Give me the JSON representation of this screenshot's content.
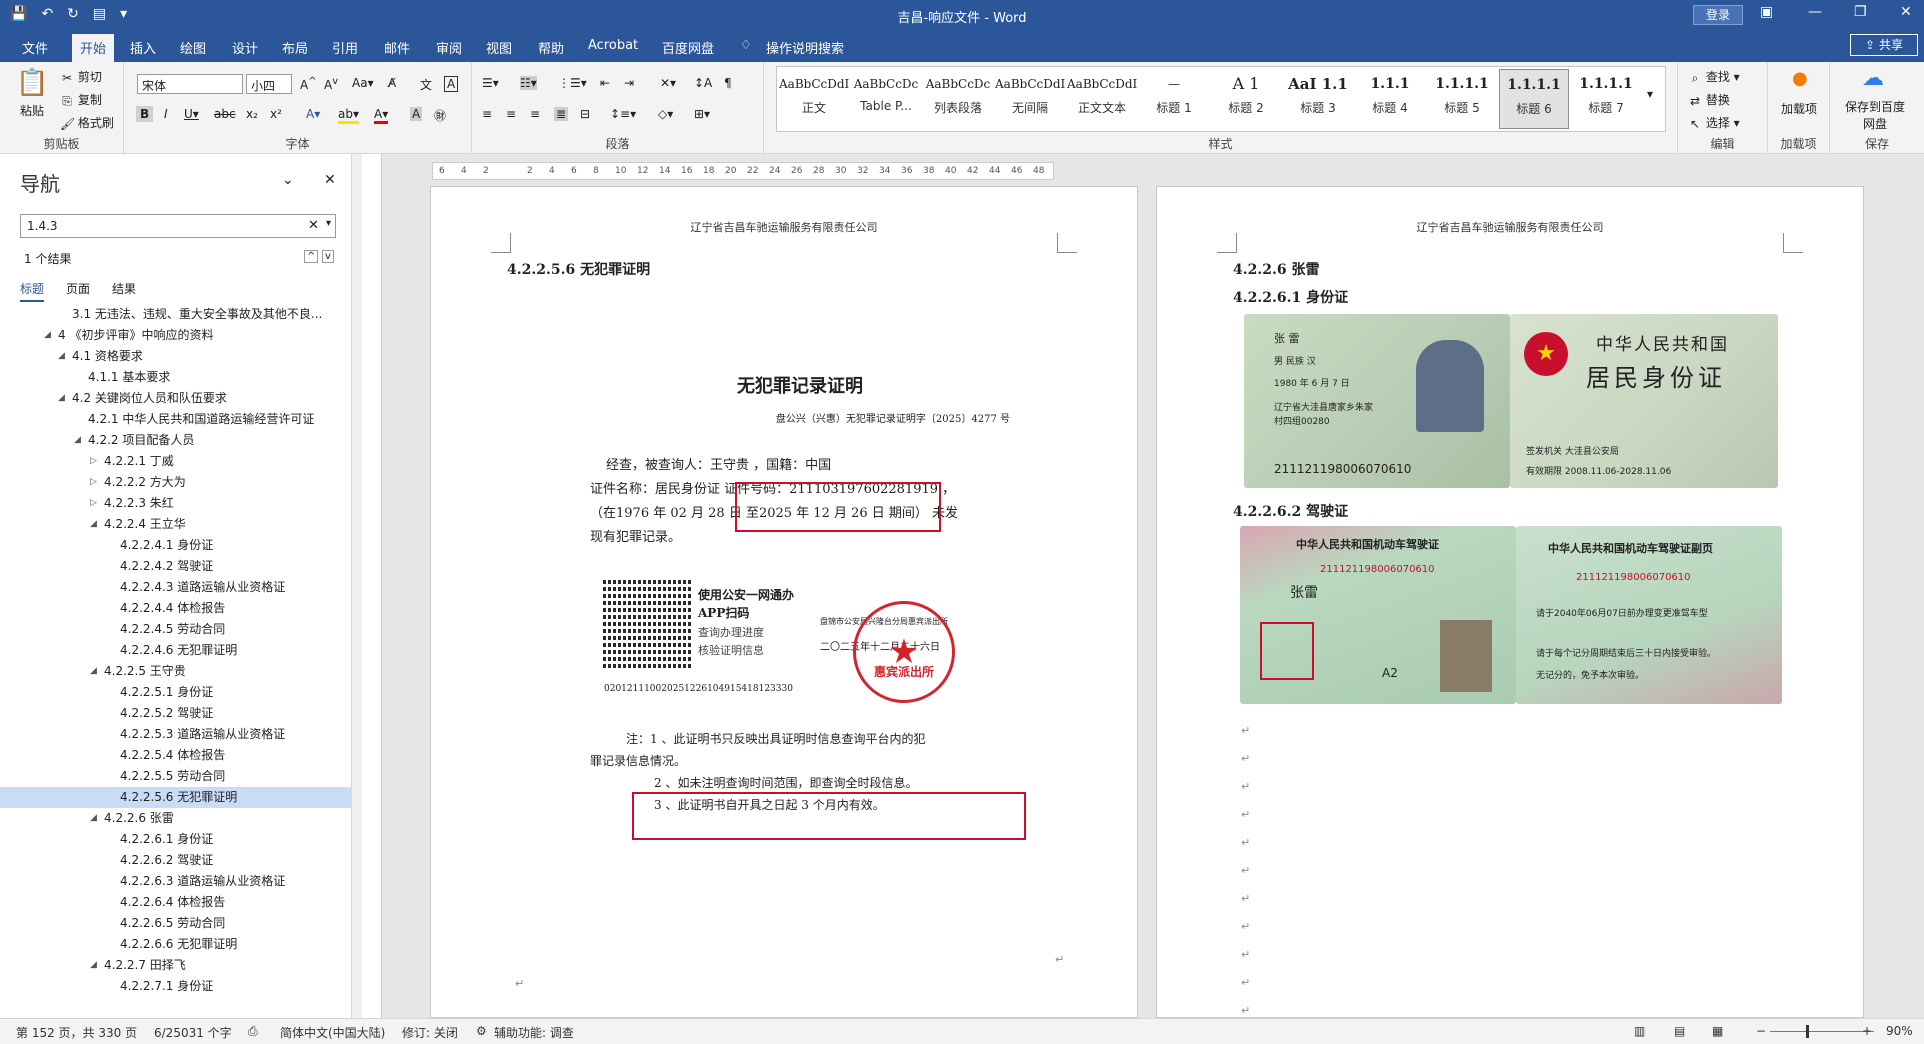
{
  "titlebar": {
    "title": "吉昌-响应文件 - Word",
    "login": "登录"
  },
  "tabs": [
    "文件",
    "开始",
    "插入",
    "绘图",
    "设计",
    "布局",
    "引用",
    "邮件",
    "审阅",
    "视图",
    "帮助",
    "Acrobat",
    "百度网盘",
    "操作说明搜索"
  ],
  "share": "共享",
  "clipboard": {
    "paste": "粘贴",
    "cut": "剪切",
    "copy": "复制",
    "format": "格式刷",
    "label": "剪贴板"
  },
  "font": {
    "name": "宋体",
    "size": "小四",
    "label": "字体"
  },
  "paragraph": {
    "label": "段落"
  },
  "styles": {
    "label": "样式",
    "items": [
      {
        "preview": "AaBbCcDdI",
        "name": "正文"
      },
      {
        "preview": "AaBbCcDc",
        "name": "Table P..."
      },
      {
        "preview": "AaBbCcDc",
        "name": "列表段落"
      },
      {
        "preview": "AaBbCcDdI",
        "name": "无间隔"
      },
      {
        "preview": "AaBbCcDdI",
        "name": "正文文本"
      },
      {
        "preview": "—",
        "name": "标题 1"
      },
      {
        "preview": "A 1",
        "name": "标题 2"
      },
      {
        "preview": "AaI 1.1",
        "name": "标题 3"
      },
      {
        "preview": "1.1.1",
        "name": "标题 4"
      },
      {
        "preview": "1.1.1.1",
        "name": "标题 5"
      },
      {
        "preview": "1.1.1.1",
        "name": "标题 6"
      },
      {
        "preview": "1.1.1.1",
        "name": "标题 7"
      }
    ]
  },
  "editing": {
    "find": "查找",
    "replace": "替换",
    "select": "选择",
    "label": "编辑"
  },
  "addins": {
    "name": "加载项",
    "label": "加载项"
  },
  "save": {
    "name": "保存到百度网盘",
    "label": "保存"
  },
  "nav": {
    "title": "导航",
    "search": "1.4.3",
    "count": "1 个结果",
    "tabs": [
      "标题",
      "页面",
      "结果"
    ],
    "items": [
      {
        "text": "3.1 无违法、违规、重大安全事故及其他不良...",
        "lvl": 0,
        "tg": ""
      },
      {
        "text": "4 《初步评审》中响应的资料",
        "lvl": 0,
        "tg": "◢"
      },
      {
        "text": "4.1 资格要求",
        "lvl": 1,
        "tg": "◢"
      },
      {
        "text": "4.1.1 基本要求",
        "lvl": 2,
        "tg": ""
      },
      {
        "text": "4.2 关键岗位人员和队伍要求",
        "lvl": 1,
        "tg": "◢"
      },
      {
        "text": "4.2.1 中华人民共和国道路运输经营许可证",
        "lvl": 2,
        "tg": ""
      },
      {
        "text": "4.2.2 项目配备人员",
        "lvl": 2,
        "tg": "◢"
      },
      {
        "text": "4.2.2.1 丁威",
        "lvl": 3,
        "tg": "▷"
      },
      {
        "text": "4.2.2.2 方大为",
        "lvl": 3,
        "tg": "▷"
      },
      {
        "text": "4.2.2.3 朱红",
        "lvl": 3,
        "tg": "▷"
      },
      {
        "text": "4.2.2.4 王立华",
        "lvl": 3,
        "tg": "◢"
      },
      {
        "text": "4.2.2.4.1 身份证",
        "lvl": 4,
        "tg": ""
      },
      {
        "text": "4.2.2.4.2 驾驶证",
        "lvl": 4,
        "tg": ""
      },
      {
        "text": "4.2.2.4.3 道路运输从业资格证",
        "lvl": 4,
        "tg": ""
      },
      {
        "text": "4.2.2.4.4 体检报告",
        "lvl": 4,
        "tg": ""
      },
      {
        "text": "4.2.2.4.5 劳动合同",
        "lvl": 4,
        "tg": ""
      },
      {
        "text": "4.2.2.4.6 无犯罪证明",
        "lvl": 4,
        "tg": ""
      },
      {
        "text": "4.2.2.5 王守贵",
        "lvl": 3,
        "tg": "◢"
      },
      {
        "text": "4.2.2.5.1 身份证",
        "lvl": 4,
        "tg": ""
      },
      {
        "text": "4.2.2.5.2 驾驶证",
        "lvl": 4,
        "tg": ""
      },
      {
        "text": "4.2.2.5.3 道路运输从业资格证",
        "lvl": 4,
        "tg": ""
      },
      {
        "text": "4.2.2.5.4 体检报告",
        "lvl": 4,
        "tg": ""
      },
      {
        "text": "4.2.2.5.5 劳动合同",
        "lvl": 4,
        "tg": ""
      },
      {
        "text": "4.2.2.5.6 无犯罪证明",
        "lvl": 4,
        "tg": "",
        "hl": true
      },
      {
        "text": "4.2.2.6 张雷",
        "lvl": 3,
        "tg": "◢"
      },
      {
        "text": "4.2.2.6.1 身份证",
        "lvl": 4,
        "tg": ""
      },
      {
        "text": "4.2.2.6.2 驾驶证",
        "lvl": 4,
        "tg": ""
      },
      {
        "text": "4.2.2.6.3 道路运输从业资格证",
        "lvl": 4,
        "tg": ""
      },
      {
        "text": "4.2.2.6.4 体检报告",
        "lvl": 4,
        "tg": ""
      },
      {
        "text": "4.2.2.6.5 劳动合同",
        "lvl": 4,
        "tg": ""
      },
      {
        "text": "4.2.2.6.6 无犯罪证明",
        "lvl": 4,
        "tg": ""
      },
      {
        "text": "4.2.2.7 田择飞",
        "lvl": 3,
        "tg": "◢"
      },
      {
        "text": "4.2.2.7.1 身份证",
        "lvl": 4,
        "tg": ""
      }
    ]
  },
  "ruler": [
    "6",
    "4",
    "2",
    "",
    "2",
    "4",
    "6",
    "8",
    "10",
    "12",
    "14",
    "16",
    "18",
    "20",
    "22",
    "24",
    "26",
    "28",
    "30",
    "32",
    "34",
    "36",
    "38",
    "40",
    "42",
    "44",
    "46",
    "48"
  ],
  "page1": {
    "header": "辽宁省吉昌车驰运输服务有限责任公司",
    "heading": "4.2.2.5.6 无犯罪证明",
    "cert": {
      "title": "无犯罪记录证明",
      "number": "盘公兴（兴惠）无犯罪记录证明字〔2025〕4277 号",
      "l1": "经查，被查询人：王守贵 ，国籍：中国",
      "l2": "证件名称：居民身份证 证件号码：211103197602281919 ，",
      "l3": "（在1976 年 02 月 28 日 至2025 年 12 月 26 日 期间） 未发",
      "l4": "现有犯罪记录。",
      "app1": "使用公安一网通办",
      "app2": "APP扫码",
      "app3": "查询办理进度",
      "app4": "核验证明信息",
      "org": "盘锦市公安局兴隆台分局惠宾派出所",
      "date": "二〇二五年十二月二十六日",
      "code": "020121110020251226104915418123330",
      "seal": "惠宾派出所",
      "n1": "注：1 、此证明书只反映出具证明时信息查询平台内的犯",
      "n2": "罪记录信息情况。",
      "n3": "2 、如未注明查询时间范围，即查询全时段信息。",
      "n4": "3 、此证明书自开具之日起 3 个月内有效。"
    }
  },
  "page2": {
    "header": "辽宁省吉昌车驰运输服务有限责任公司",
    "h1": "4.2.2.6 张雷",
    "h2": "4.2.2.6.1 身份证",
    "h3": "4.2.2.6.2 驾驶证",
    "id": {
      "name": "张 雷",
      "sex": "男 民族 汉",
      "birth": "1980 年 6 月 7 日",
      "addr1": "辽宁省大洼县唐家乡朱家",
      "addr2": "村四组00280",
      "num": "211121198006070610",
      "country": "中华人民共和国",
      "title": "居民身份证",
      "auth": "签发机关 大洼县公安局",
      "valid": "有效期限 2008.11.06-2028.11.06"
    },
    "dl": {
      "title": "中华人民共和国机动车驾驶证",
      "sub": "中华人民共和国机动车驾驶证副页",
      "num": "211121198006070610",
      "name": "张雷",
      "cls": "A2",
      "note1": "请于2040年06月07日前办理变更准驾车型",
      "note2": "请于每个记分周期结束后三十日内接受审验。",
      "note3": "无记分的，免予本次审验。"
    }
  },
  "status": {
    "page": "第 152 页，共 330 页",
    "words": "6/25031 个字",
    "lang": "简体中文(中国大陆)",
    "track": "修订: 关闭",
    "access": "辅助功能: 调查",
    "zoom": "90%"
  }
}
